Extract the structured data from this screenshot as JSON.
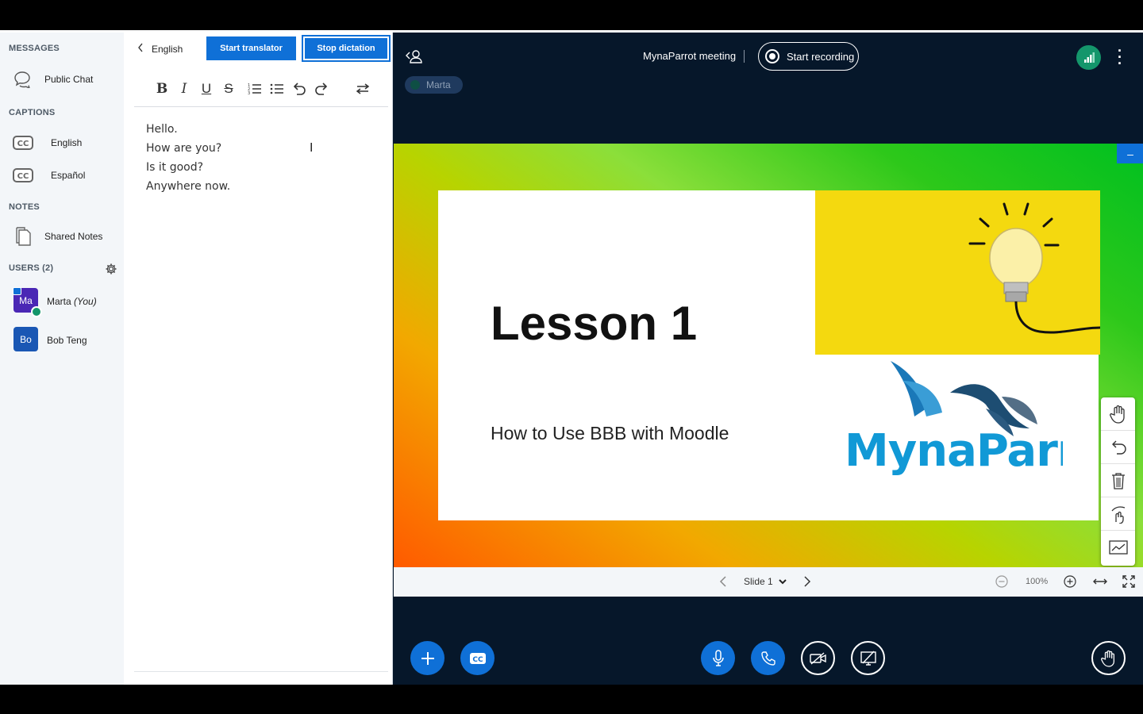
{
  "sidebar": {
    "messages_title": "MESSAGES",
    "public_chat": "Public Chat",
    "captions_title": "CAPTIONS",
    "captions": [
      "English",
      "Español"
    ],
    "notes_title": "NOTES",
    "shared_notes": "Shared Notes",
    "users_title": "USERS (2)",
    "users": [
      {
        "initials": "Ma",
        "name": "Marta",
        "suffix": "(You)",
        "color": "#4a27b5"
      },
      {
        "initials": "Bo",
        "name": "Bob Teng",
        "suffix": "",
        "color": "#1a57b4"
      }
    ]
  },
  "notes_panel": {
    "back_label": "English",
    "start_translator": "Start translator",
    "stop_dictation": "Stop dictation",
    "lines": [
      "Hello.",
      "How are you?",
      "Is it good?",
      "Anywhere now."
    ]
  },
  "header": {
    "meeting_title": "MynaParrot meeting",
    "record_label": "Start recording",
    "talking": "Marta"
  },
  "slide": {
    "title": "Lesson 1",
    "subtitle": "How to Use BBB with Moodle",
    "logo_text": "MynaParrot"
  },
  "slide_controls": {
    "slide_label": "Slide 1",
    "zoom": "100%"
  },
  "colors": {
    "primary": "#0f70d7",
    "main_bg": "#06172a",
    "sidebar_bg": "#f3f6f9",
    "connection": "#14966b"
  }
}
